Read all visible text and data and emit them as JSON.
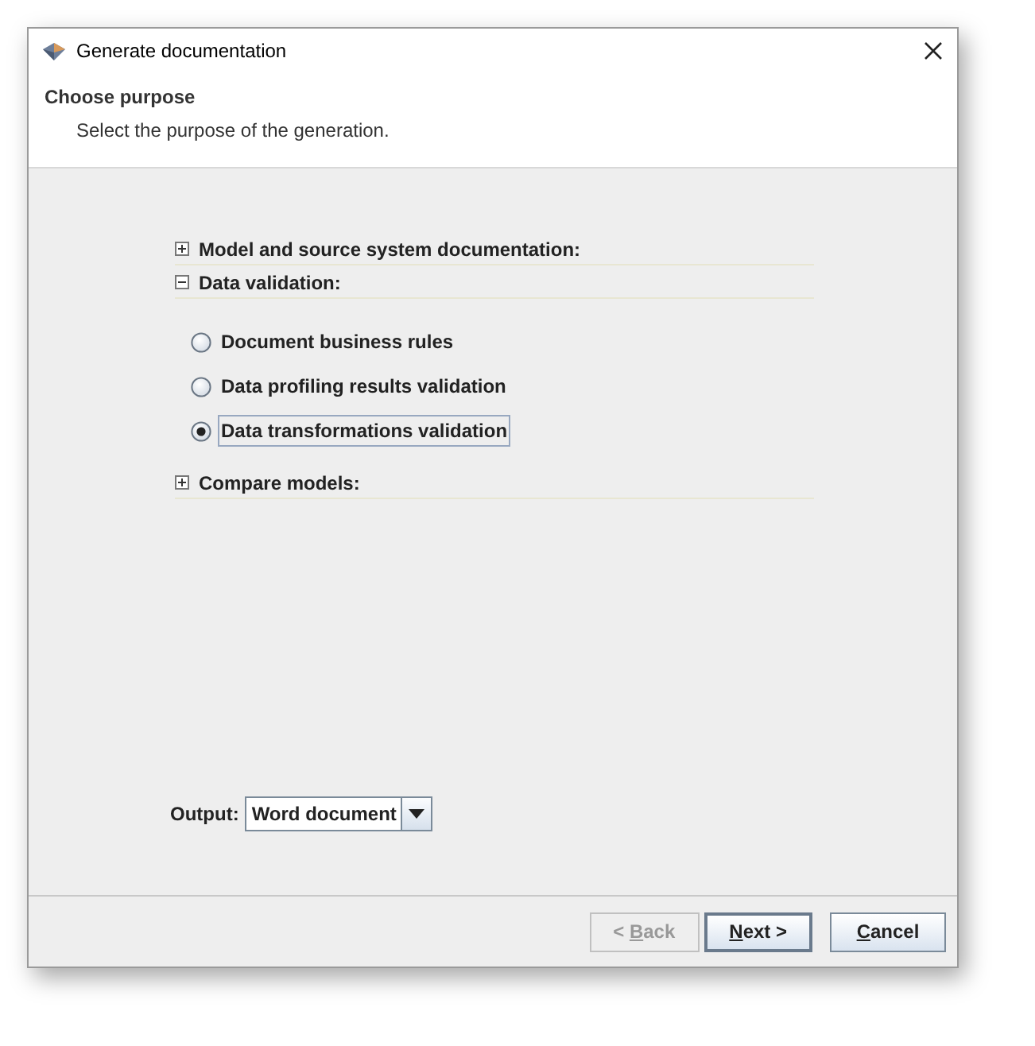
{
  "window": {
    "title": "Generate documentation"
  },
  "header": {
    "title": "Choose purpose",
    "subtitle": "Select the purpose of the generation."
  },
  "sections": [
    {
      "label": "Model and source system documentation:",
      "expanded": false
    },
    {
      "label": "Data validation:",
      "expanded": true,
      "options": [
        {
          "label": "Document business rules",
          "selected": false
        },
        {
          "label": "Data profiling results validation",
          "selected": false
        },
        {
          "label": "Data transformations validation",
          "selected": true
        }
      ]
    },
    {
      "label": "Compare models:",
      "expanded": false
    }
  ],
  "output": {
    "label": "Output:",
    "value": "Word document"
  },
  "buttons": [
    {
      "before": "< ",
      "key": "B",
      "after": "ack",
      "disabled": true,
      "default": false
    },
    {
      "key": "N",
      "after": "ext >",
      "disabled": false,
      "default": true
    },
    {
      "key": "C",
      "after": "ancel",
      "disabled": false,
      "default": false
    }
  ]
}
